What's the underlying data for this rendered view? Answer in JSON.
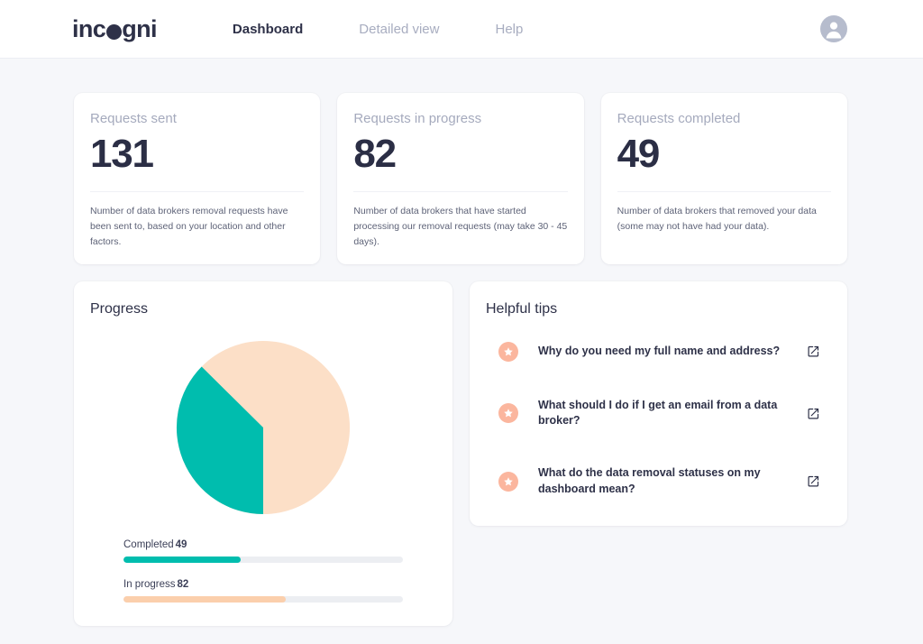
{
  "brand": {
    "logo_text_before": "inc",
    "logo_dot": "o",
    "logo_text_after": "gni",
    "logo_full": "incogni"
  },
  "nav": {
    "items": [
      {
        "label": "Dashboard",
        "active": true
      },
      {
        "label": "Detailed view",
        "active": false
      },
      {
        "label": "Help",
        "active": false
      }
    ],
    "avatar_icon": "user-avatar-icon"
  },
  "stats": [
    {
      "label": "Requests sent",
      "value": "131",
      "description": "Number of data brokers removal requests have been sent to, based on your location and other factors."
    },
    {
      "label": "Requests in progress",
      "value": "82",
      "description": "Number of data brokers that have started processing our removal requests (may take 30 - 45 days)."
    },
    {
      "label": "Requests completed",
      "value": "49",
      "description": "Number of data brokers that removed your data (some may not have had your data)."
    }
  ],
  "progress_panel": {
    "title": "Progress",
    "bars": [
      {
        "label": "Completed",
        "value": "49",
        "percent": 42,
        "color": "#00bdae"
      },
      {
        "label": "In progress",
        "value": "82",
        "percent": 58,
        "color": "#fbcfac"
      }
    ]
  },
  "tips_panel": {
    "title": "Helpful tips",
    "items": [
      {
        "text": "Why do you need my full name and address?",
        "badge_icon": "star-icon",
        "link_icon": "external-link-icon"
      },
      {
        "text": "What should I do if I get an email from a data broker?",
        "badge_icon": "star-icon",
        "link_icon": "external-link-icon"
      },
      {
        "text": "What do the data removal statuses on my dashboard mean?",
        "badge_icon": "star-icon",
        "link_icon": "external-link-icon"
      }
    ]
  },
  "chart_data": {
    "type": "pie",
    "title": "Progress",
    "categories": [
      "Completed",
      "In progress"
    ],
    "values": [
      49,
      82
    ],
    "colors": [
      "#00bdae",
      "#fcdfc7"
    ],
    "total": 131,
    "percentages": [
      37.4,
      62.6
    ],
    "start_angle_deg": 90,
    "direction": "clockwise",
    "legend": "none",
    "labels_shown": false
  },
  "colors": {
    "page_background": "#f6f7fa",
    "card_background": "#ffffff",
    "text_dark": "#2e3148",
    "text_muted": "#a5aabd",
    "teal": "#00bdae",
    "peach_light": "#fcdfc7",
    "peach_bar": "#fbcfac",
    "badge_salmon": "#fbb69e",
    "track_gray": "#eceef2"
  }
}
